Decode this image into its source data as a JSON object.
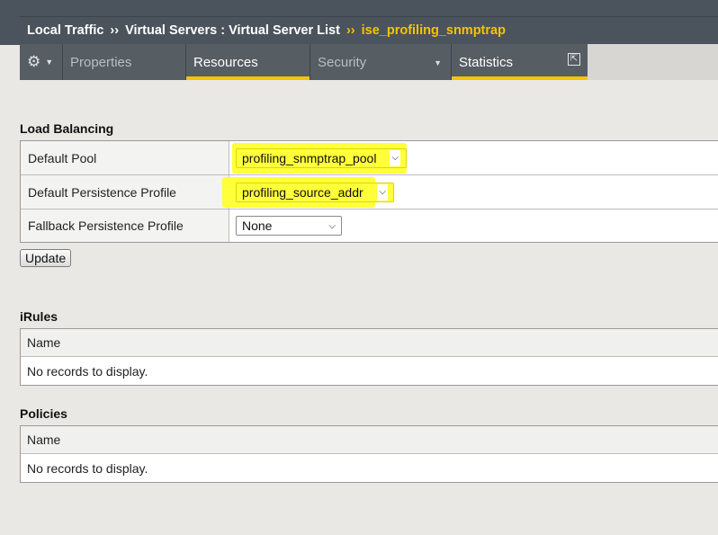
{
  "breadcrumb": {
    "items": [
      "Local Traffic",
      "Virtual Servers : Virtual Server List"
    ],
    "separator": "››",
    "current": "ise_profiling_snmptrap"
  },
  "tabs": {
    "gear_icon": "⚙",
    "caret": "▼",
    "items": [
      {
        "label": "Properties"
      },
      {
        "label": "Resources"
      },
      {
        "label": "Security"
      },
      {
        "label": "Statistics"
      }
    ],
    "popout_icon": "⇱"
  },
  "load_balancing": {
    "title": "Load Balancing",
    "rows": [
      {
        "label": "Default Pool",
        "value": "profiling_snmptrap_pool"
      },
      {
        "label": "Default Persistence Profile",
        "value": "profiling_source_addr"
      },
      {
        "label": "Fallback Persistence Profile",
        "value": "None"
      }
    ],
    "update_button": "Update"
  },
  "irules": {
    "title": "iRules",
    "column": "Name",
    "empty": "No records to display."
  },
  "policies": {
    "title": "Policies",
    "column": "Name",
    "empty": "No records to display."
  },
  "colors": {
    "accent": "#f5c400",
    "highlight": "#ffff3a",
    "header_bg": "#4b545c"
  }
}
